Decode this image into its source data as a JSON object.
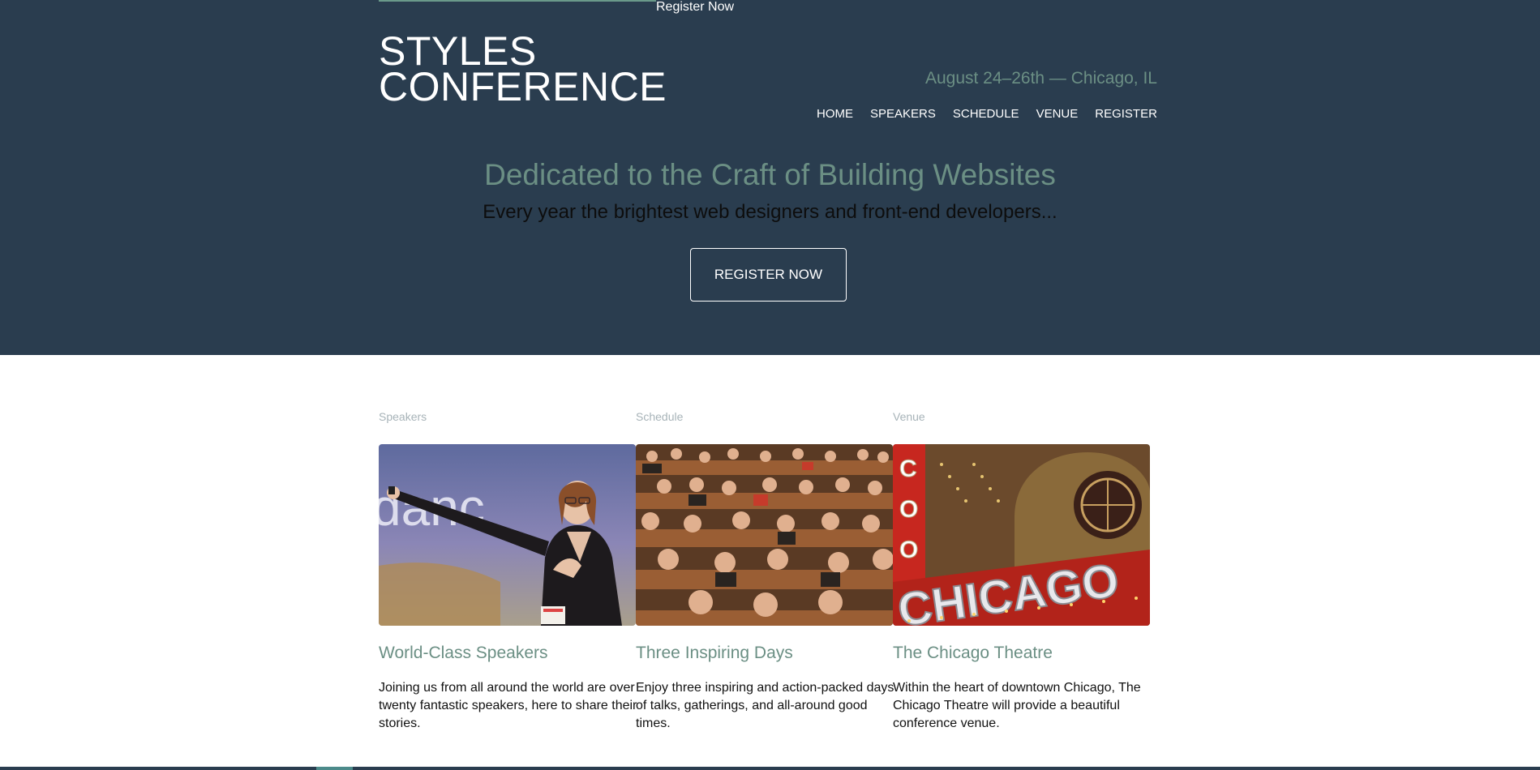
{
  "header": {
    "top_register": "Register Now",
    "logo_line1": "STYLES",
    "logo_line2": "CONFERENCE",
    "dates": "August 24–26th — Chicago, IL",
    "nav": [
      "HOME",
      "SPEAKERS",
      "SCHEDULE",
      "VENUE",
      "REGISTER"
    ]
  },
  "hero": {
    "tagline": "Dedicated to the Craft of Building Websites",
    "subtag": "Every year the brightest web designers and front-end developers...",
    "cta": "REGISTER NOW"
  },
  "columns": [
    {
      "label": "Speakers",
      "title": "World-Class Speakers",
      "desc": "Joining us from all around the world are over twenty fantastic speakers, here to share their stories."
    },
    {
      "label": "Schedule",
      "title": "Three Inspiring Days",
      "desc": "Enjoy three inspiring and action-packed days of talks, gatherings, and all-around good times."
    },
    {
      "label": "Venue",
      "title": "The Chicago Theatre",
      "desc": "Within the heart of downtown Chicago, The Chicago Theatre will provide a beautiful conference venue."
    }
  ],
  "images": {
    "speaker_slide_text": "danc",
    "theatre_sign_text": "CHICAGO",
    "vertical_sign_letters": [
      "C",
      "O",
      "O"
    ]
  },
  "colors": {
    "hero_bg": "#2a3d4f",
    "accent": "#6b8f84",
    "label_gray": "#a7b3b8"
  }
}
